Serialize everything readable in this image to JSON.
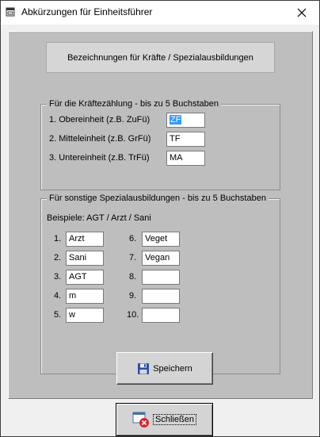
{
  "window": {
    "title": "Abkürzungen für Einheitsführer"
  },
  "header": {
    "title": "Bezeichnungen für Kräfte / Spezialausbildungen"
  },
  "forces": {
    "legend": "Für die Kräftezählung - bis zu 5 Buchstaben",
    "rows": [
      {
        "label": "1. Obereinheit (z.B. ZuFü)",
        "value": "ZF"
      },
      {
        "label": "2. Mitteleinheit (z.B. GrFü)",
        "value": "TF"
      },
      {
        "label": "3. Untereinheit (z.B. TrFü)",
        "value": "MA"
      }
    ]
  },
  "special": {
    "legend": "Für sonstige Spezialausbildungen - bis zu 5 Buchstaben",
    "example": "Beispiele: AGT / Arzt / Sani",
    "items": [
      {
        "num": "1.",
        "value": "Arzt"
      },
      {
        "num": "2.",
        "value": "Sani"
      },
      {
        "num": "3.",
        "value": "AGT"
      },
      {
        "num": "4.",
        "value": "m"
      },
      {
        "num": "5.",
        "value": "w"
      },
      {
        "num": "6.",
        "value": "Veget"
      },
      {
        "num": "7.",
        "value": "Vegan"
      },
      {
        "num": "8.",
        "value": ""
      },
      {
        "num": "9.",
        "value": ""
      },
      {
        "num": "10.",
        "value": ""
      }
    ]
  },
  "buttons": {
    "save_label": "Speichern",
    "close_label": "Schließen",
    "save_icon": "floppy-disk-icon",
    "close_icon": "window-close-icon"
  },
  "colors": {
    "panel": "#bebebe",
    "selection": "#3399ff",
    "close_red": "#d9232d"
  }
}
